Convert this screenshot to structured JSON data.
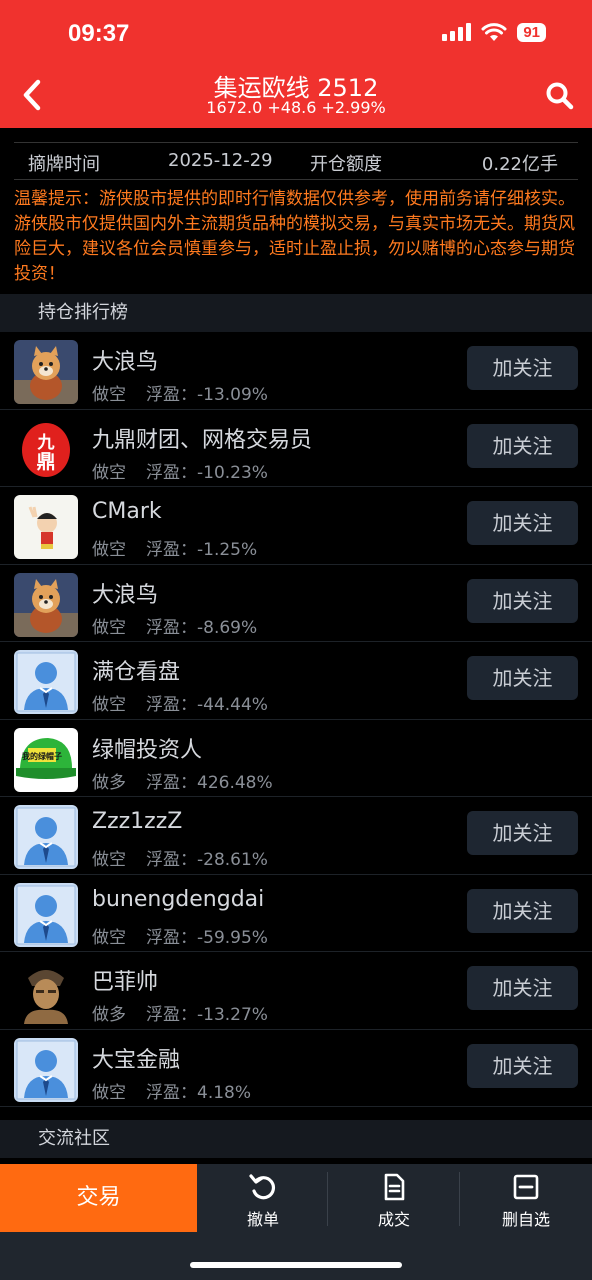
{
  "status": {
    "time": "09:37",
    "battery": "91"
  },
  "header": {
    "title": "集运欧线 2512",
    "subtitle": "1672.0  +48.6  +2.99%"
  },
  "info": {
    "label1": "摘牌时间",
    "value1": "2025-12-29",
    "label2": "开仓额度",
    "value2": "0.22亿手"
  },
  "notice": "温馨提示：游侠股市提供的即时行情数据仅供参考，使用前务请仔细核实。游侠股市仅提供国内外主流期货品种的模拟交易，与真实市场无关。期货风险巨大，建议各位会员慎重参与，适时止盈止损，勿以赌博的心态参与期货投资！",
  "sections": {
    "ranking": "持仓排行榜",
    "community": "交流社区"
  },
  "follow_label": "加关注",
  "profit_label": "浮盈：",
  "ranking": [
    {
      "name": "大浪鸟",
      "dir": "做空",
      "profit": "-13.09%",
      "avatar": "shiba-icon",
      "follow": true
    },
    {
      "name": "九鼎财团、网格交易员",
      "dir": "做空",
      "profit": "-10.23%",
      "avatar": "jiuding-logo-icon",
      "follow": true
    },
    {
      "name": "CMark",
      "dir": "做空",
      "profit": "-1.25%",
      "avatar": "cartoon-boy-icon",
      "follow": true
    },
    {
      "name": "大浪鸟",
      "dir": "做空",
      "profit": "-8.69%",
      "avatar": "shiba-icon",
      "follow": true
    },
    {
      "name": "满仓看盘",
      "dir": "做空",
      "profit": "-44.44%",
      "avatar": "default-user-icon",
      "follow": true
    },
    {
      "name": "绿帽投资人",
      "dir": "做多",
      "profit": "426.48%",
      "avatar": "green-cap-icon",
      "follow": false
    },
    {
      "name": "Zzz1zzZ",
      "dir": "做空",
      "profit": "-28.61%",
      "avatar": "default-user-icon",
      "follow": true
    },
    {
      "name": "bunengdengdai",
      "dir": "做空",
      "profit": "-59.95%",
      "avatar": "default-user-icon",
      "follow": true
    },
    {
      "name": "巴菲帅",
      "dir": "做多",
      "profit": "-13.27%",
      "avatar": "warrior-icon",
      "follow": true
    },
    {
      "name": "大宝金融",
      "dir": "做空",
      "profit": "4.18%",
      "avatar": "default-user-icon",
      "follow": true
    }
  ],
  "bottom": {
    "trade": "交易",
    "cancel": "撤单",
    "deal": "成交",
    "remove_watch": "删自选"
  },
  "avatar_text": {
    "jiuding": "九鼎",
    "cap": "我的绿帽子"
  },
  "colors": {
    "header": "#f0322e",
    "accent": "#ff6a11",
    "notice": "#ff7a1f"
  }
}
